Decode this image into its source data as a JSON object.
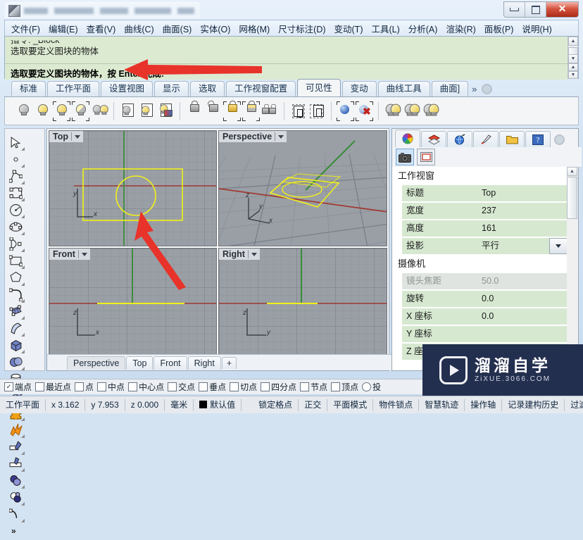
{
  "window": {
    "title_obscured": true,
    "minimize_label": "–",
    "maximize_label": "□",
    "close_label": "✕"
  },
  "menubar": {
    "items": [
      {
        "label": "文件(F)"
      },
      {
        "label": "编辑(E)"
      },
      {
        "label": "查看(V)"
      },
      {
        "label": "曲线(C)"
      },
      {
        "label": "曲面(S)"
      },
      {
        "label": "实体(O)"
      },
      {
        "label": "网格(M)"
      },
      {
        "label": "尺寸标注(D)"
      },
      {
        "label": "变动(T)"
      },
      {
        "label": "工具(L)"
      },
      {
        "label": "分析(A)"
      },
      {
        "label": "渲染(R)"
      },
      {
        "label": "面板(P)"
      },
      {
        "label": "说明(H)"
      }
    ]
  },
  "command": {
    "history_cut": "指令: _Block",
    "history_line": "选取要定义图块的物体",
    "prompt": "选取要定义图块的物体，按 Enter 完成:"
  },
  "ribbon": {
    "tabs": [
      {
        "label": "标准",
        "active": false
      },
      {
        "label": "工作平面",
        "active": false
      },
      {
        "label": "设置视图",
        "active": false
      },
      {
        "label": "显示",
        "active": false
      },
      {
        "label": "选取",
        "active": false
      },
      {
        "label": "工作视窗配置",
        "active": false
      },
      {
        "label": "可见性",
        "active": true
      },
      {
        "label": "变动",
        "active": false
      },
      {
        "label": "曲线工具",
        "active": false
      },
      {
        "label": "曲面]",
        "active": false
      }
    ],
    "overflow_label": "»",
    "gear_icon": "gear-icon",
    "tools": [
      {
        "name": "hide-objects-icon",
        "kind": "bulb",
        "tone": "grey"
      },
      {
        "name": "show-objects-icon",
        "kind": "bulb",
        "tone": "yellow"
      },
      {
        "name": "show-selected-icon",
        "kind": "bulb",
        "tone": "yellow",
        "marks": true
      },
      {
        "name": "invert-hide-icon",
        "kind": "bulb",
        "tone": "half",
        "marks": true
      },
      {
        "name": "swap-hidden-icon",
        "kind": "bulb2",
        "tone": "grey"
      },
      {
        "sep": true
      },
      {
        "name": "hide-layer-icon",
        "kind": "page",
        "tone": "grey"
      },
      {
        "name": "show-layer-icon",
        "kind": "page",
        "tone": "yellow"
      },
      {
        "name": "layer-state-icon",
        "kind": "page",
        "tone": "multi"
      },
      {
        "sep2": true
      },
      {
        "name": "lock-objects-icon",
        "kind": "lock",
        "tone": "grey"
      },
      {
        "name": "unlock-objects-icon",
        "kind": "lock-open",
        "tone": "grey"
      },
      {
        "name": "unlock-selected-icon",
        "kind": "lock",
        "tone": "gold",
        "marks": true
      },
      {
        "name": "invert-lock-icon",
        "kind": "lock",
        "tone": "half",
        "marks": true
      },
      {
        "name": "swap-locked-icon",
        "kind": "lock2",
        "tone": "grey"
      },
      {
        "sep": true
      },
      {
        "name": "isolate-selection-icon",
        "kind": "selbox"
      },
      {
        "name": "isolate-multi-icon",
        "kind": "selbox2"
      },
      {
        "sep": true
      },
      {
        "name": "show-render-mesh-icon",
        "kind": "ball"
      },
      {
        "name": "hide-render-mesh-icon",
        "kind": "ball-x"
      },
      {
        "sep": true
      },
      {
        "name": "light-on-icon",
        "kind": "bulb-big",
        "tone": "half"
      },
      {
        "name": "light-off-icon",
        "kind": "bulb-big",
        "tone": "half"
      },
      {
        "name": "light-toggle-icon",
        "kind": "bulb-big",
        "tone": "half"
      }
    ]
  },
  "left_toolbar": {
    "items": [
      {
        "name": "select-arrow-icon"
      },
      {
        "name": "point-icon"
      },
      {
        "name": "polyline-icon"
      },
      {
        "name": "curve-icon"
      },
      {
        "name": "circle-icon"
      },
      {
        "name": "ellipse-icon"
      },
      {
        "name": "arc-icon"
      },
      {
        "name": "rectangle-icon"
      },
      {
        "name": "polygon-icon"
      },
      {
        "name": "fillet-icon"
      },
      {
        "name": "surface-from-points-icon"
      },
      {
        "name": "surface-loft-icon"
      },
      {
        "name": "box-solid-icon"
      },
      {
        "name": "sphere-boolean-icon"
      },
      {
        "name": "cylinder-icon"
      },
      {
        "name": "mesh-plane-icon"
      },
      {
        "name": "puzzle-icon"
      },
      {
        "name": "explode-icon"
      },
      {
        "name": "trim-icon"
      },
      {
        "name": "split-icon"
      },
      {
        "name": "boolean-union-icon"
      },
      {
        "name": "boolean-difference-icon"
      },
      {
        "name": "blend-curve-icon"
      },
      {
        "name": "more-tools-icon",
        "label": "»"
      }
    ]
  },
  "viewports": [
    {
      "id": "top",
      "label": "Top",
      "axes": [
        "y",
        "x"
      ],
      "active": false
    },
    {
      "id": "perspective",
      "label": "Perspective",
      "axes": [
        "z",
        "y",
        "x"
      ],
      "active": false
    },
    {
      "id": "front",
      "label": "Front",
      "axes": [
        "z",
        "x"
      ],
      "active": false
    },
    {
      "id": "right",
      "label": "Right",
      "axes": [
        "z",
        "y"
      ],
      "active": false
    }
  ],
  "viewport_tabs": [
    {
      "label": "Perspective",
      "active": true
    },
    {
      "label": "Top",
      "active": false
    },
    {
      "label": "Front",
      "active": false
    },
    {
      "label": "Right",
      "active": false
    },
    {
      "label": "+",
      "active": false
    }
  ],
  "panel": {
    "tabs": [
      {
        "name": "material-tab-icon",
        "active": true
      },
      {
        "name": "layers-tab-icon",
        "active": false
      },
      {
        "name": "environment-tab-icon",
        "active": false
      },
      {
        "name": "render-tab-icon",
        "active": false
      },
      {
        "name": "libraries-tab-icon",
        "active": false
      },
      {
        "name": "help-tab-icon",
        "active": false
      }
    ],
    "gear_icon": "panel-options-gear-icon",
    "subtools": [
      {
        "name": "camera-properties-icon",
        "state": "selected"
      },
      {
        "name": "viewport-properties-icon",
        "state": "selected2"
      }
    ],
    "groups": [
      {
        "title": "工作视窗",
        "rows": [
          {
            "key": "标题",
            "value": "Top",
            "disabled": false,
            "combo": false
          },
          {
            "key": "宽度",
            "value": "237",
            "disabled": false,
            "combo": false
          },
          {
            "key": "高度",
            "value": "161",
            "disabled": false,
            "combo": false
          },
          {
            "key": "投影",
            "value": "平行",
            "disabled": false,
            "combo": true
          }
        ]
      },
      {
        "title": "摄像机",
        "rows": [
          {
            "key": "镜头焦距",
            "value": "50.0",
            "disabled": true,
            "combo": false
          },
          {
            "key": "旋转",
            "value": "0.0",
            "disabled": false,
            "combo": false
          },
          {
            "key": "X 座标",
            "value": "0.0",
            "disabled": false,
            "combo": false
          },
          {
            "key": "Y 座标",
            "value": "",
            "disabled": false,
            "combo": false
          },
          {
            "key": "Z 座标",
            "value": "",
            "disabled": false,
            "combo": false
          }
        ]
      }
    ]
  },
  "osnap": {
    "items": [
      {
        "label": "端点",
        "checked": true,
        "type": "check"
      },
      {
        "label": "最近点",
        "checked": false,
        "type": "check"
      },
      {
        "label": "点",
        "checked": false,
        "type": "check"
      },
      {
        "label": "中点",
        "checked": false,
        "type": "check"
      },
      {
        "label": "中心点",
        "checked": false,
        "type": "check"
      },
      {
        "label": "交点",
        "checked": false,
        "type": "check"
      },
      {
        "label": "垂点",
        "checked": false,
        "type": "check"
      },
      {
        "label": "切点",
        "checked": false,
        "type": "check"
      },
      {
        "label": "四分点",
        "checked": false,
        "type": "check"
      },
      {
        "label": "节点",
        "checked": false,
        "type": "check"
      },
      {
        "label": "顶点",
        "checked": false,
        "type": "check"
      },
      {
        "label": "投",
        "checked": false,
        "type": "radio"
      }
    ]
  },
  "statusbar": {
    "cplane": "工作平面",
    "x": "x 3.162",
    "y": "y 7.953",
    "z": "z 0.000",
    "units": "毫米",
    "layer": "默认值",
    "toggles": [
      "锁定格点",
      "正交",
      "平面模式",
      "物件锁点",
      "智慧轨迹",
      "操作轴",
      "记录建构历史",
      "过滤器"
    ]
  },
  "watermark": {
    "title": "溜溜自学",
    "url": "ZiXUE.3066.COM"
  }
}
